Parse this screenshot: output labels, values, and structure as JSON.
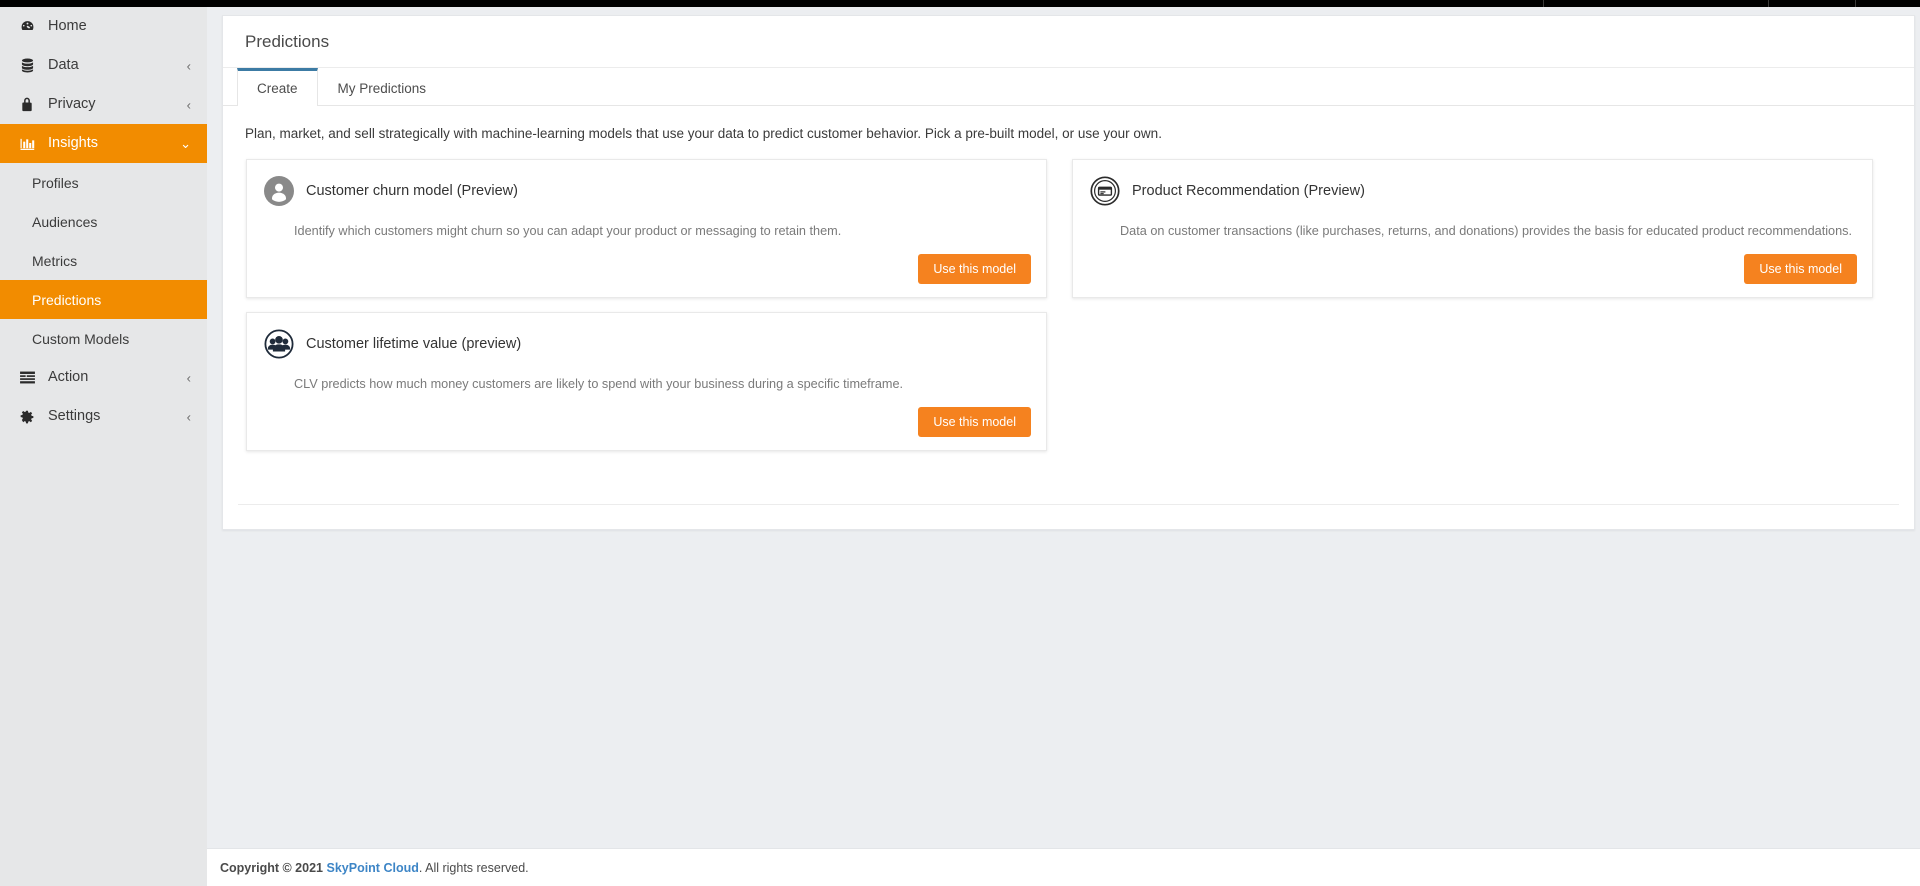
{
  "sidebar": {
    "items": [
      {
        "label": "Home",
        "icon": "dashboard-icon",
        "chevron": "",
        "active": false,
        "sub": false
      },
      {
        "label": "Data",
        "icon": "database-icon",
        "chevron": "‹",
        "active": false,
        "sub": false
      },
      {
        "label": "Privacy",
        "icon": "lock-icon",
        "chevron": "‹",
        "active": false,
        "sub": false
      },
      {
        "label": "Insights",
        "icon": "chart-bar-icon",
        "chevron": "⌄",
        "active": true,
        "sub": false
      },
      {
        "label": "Profiles",
        "icon": "",
        "chevron": "",
        "active": false,
        "sub": true
      },
      {
        "label": "Audiences",
        "icon": "",
        "chevron": "",
        "active": false,
        "sub": true
      },
      {
        "label": "Metrics",
        "icon": "",
        "chevron": "",
        "active": false,
        "sub": true
      },
      {
        "label": "Predictions",
        "icon": "",
        "chevron": "",
        "active": true,
        "sub": true
      },
      {
        "label": "Custom Models",
        "icon": "",
        "chevron": "",
        "active": false,
        "sub": true
      },
      {
        "label": "Action",
        "icon": "list-icon",
        "chevron": "‹",
        "active": false,
        "sub": false
      },
      {
        "label": "Settings",
        "icon": "gear-icon",
        "chevron": "‹",
        "active": false,
        "sub": false
      }
    ]
  },
  "page": {
    "title": "Predictions",
    "intro": "Plan, market, and sell strategically with machine-learning models that use your data to predict customer behavior. Pick a pre-built model, or use your own.",
    "tabs": [
      {
        "label": "Create",
        "active": true
      },
      {
        "label": "My Predictions",
        "active": false
      }
    ]
  },
  "cards": [
    {
      "icon": "person-circle-icon",
      "title": "Customer churn model (Preview)",
      "description": "Identify which customers might churn so you can adapt your product or messaging to retain them.",
      "button": "Use this model"
    },
    {
      "icon": "product-card-icon",
      "title": "Product Recommendation (Preview)",
      "description": "Data on customer transactions (like purchases, returns, and donations) provides the basis for educated product recommendations.",
      "button": "Use this model"
    },
    {
      "icon": "people-group-icon",
      "title": "Customer lifetime value (preview)",
      "description": "CLV predicts how much money customers are likely to spend with your business during a specific timeframe.",
      "button": "Use this model"
    }
  ],
  "footer": {
    "copyright": "Copyright © 2021",
    "brand": "SkyPoint Cloud",
    "rights": ". All rights reserved."
  },
  "colors": {
    "accent_orange": "#f5821f",
    "sidebar_active": "#f28c00",
    "tab_indicator": "#3c7ba4",
    "brand_blue": "#3d85c6",
    "sidebar_bg": "#e6e7e8",
    "page_bg": "#eceef1"
  }
}
